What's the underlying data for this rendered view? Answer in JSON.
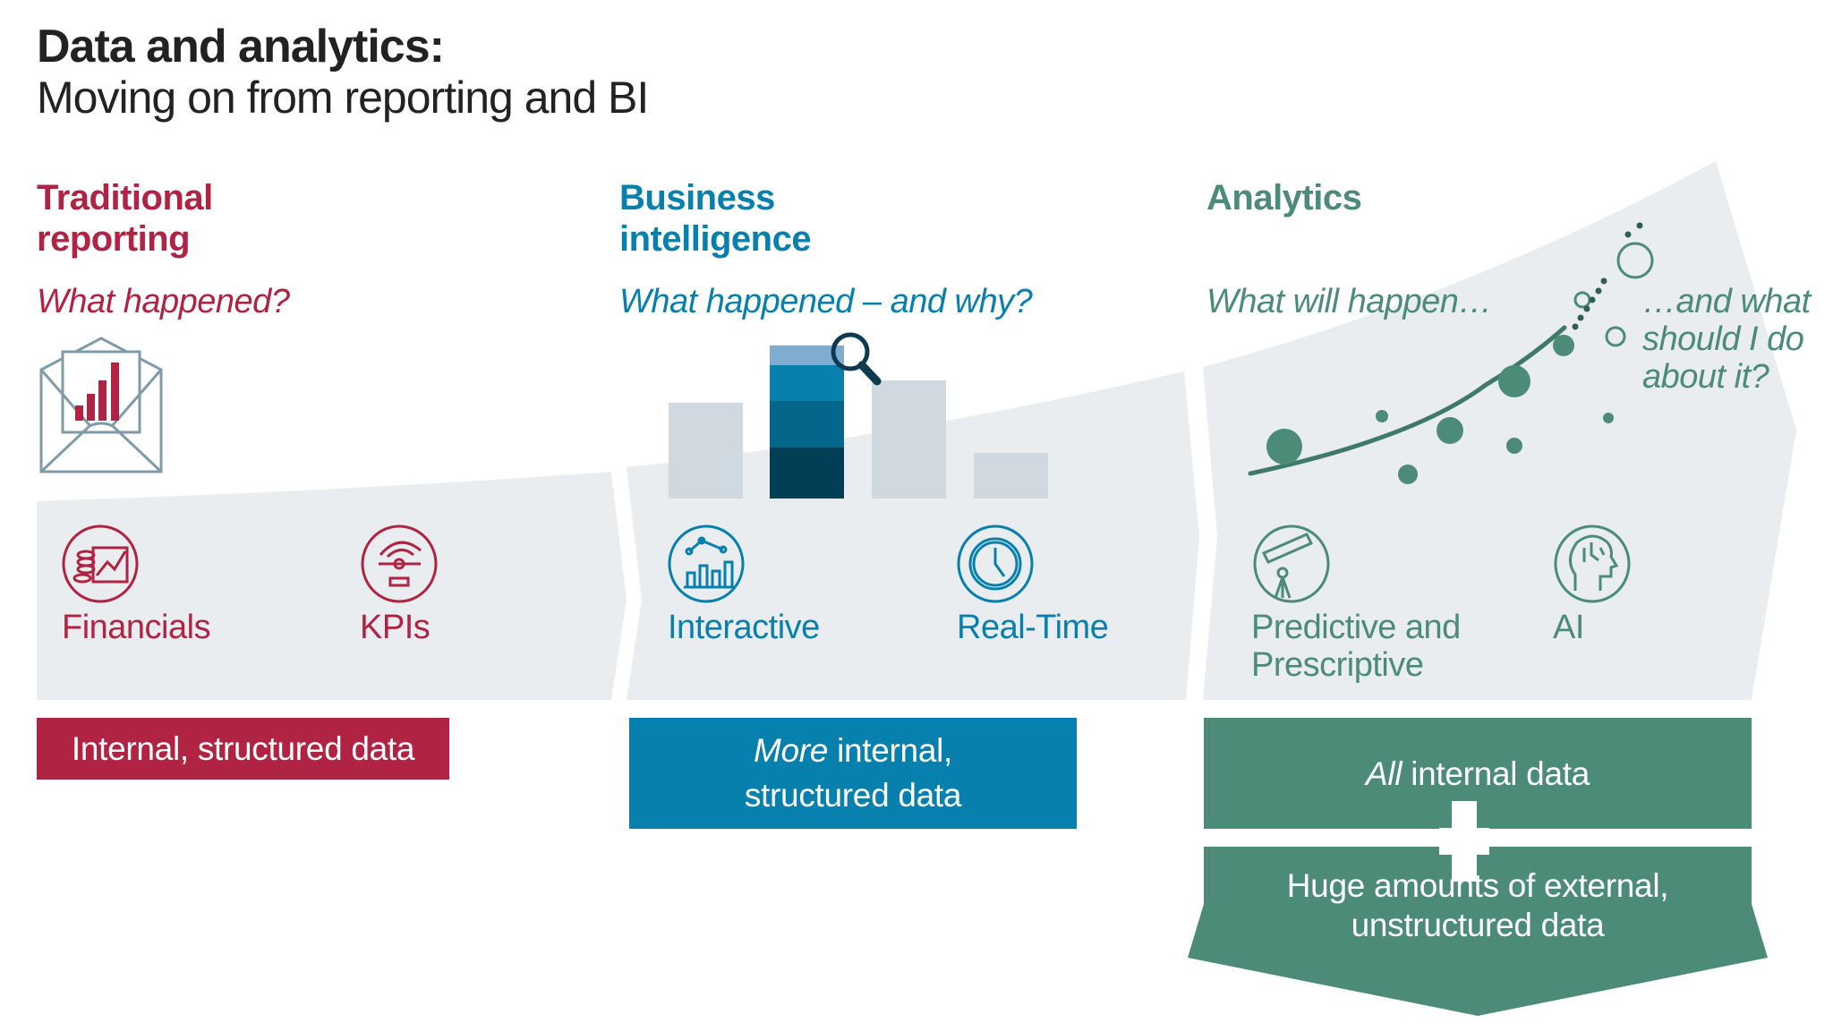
{
  "header": {
    "title": "Data and analytics:",
    "subtitle": "Moving on from reporting and BI"
  },
  "colors": {
    "traditional": "#b02343",
    "bi": "#0780ae",
    "analytics": "#4b8b78",
    "band": "#e9edf0",
    "bar_gray": "#cfd9df",
    "text_dark": "#222222"
  },
  "columns": [
    {
      "heading_line1": "Traditional",
      "heading_line2": "reporting",
      "question": "What happened?",
      "illustration": "envelope-report-icon",
      "features": [
        {
          "label": "Financials",
          "icon": "financials-coins-chart-icon"
        },
        {
          "label": "KPIs",
          "icon": "kpi-gauge-icon"
        }
      ],
      "data_box": {
        "lines": [
          "Internal, structured data"
        ]
      }
    },
    {
      "heading_line1": "Business",
      "heading_line2": "intelligence",
      "question": "What happened – and why?",
      "illustration": "bar-chart-magnifier-icon",
      "features": [
        {
          "label": "Interactive",
          "icon": "interactive-chart-cursor-icon"
        },
        {
          "label": "Real-Time",
          "icon": "clock-icon"
        }
      ],
      "data_box": {
        "emphasis": "More",
        "rest_line1": " internal,",
        "line2": "structured data"
      }
    },
    {
      "heading_line1": "Analytics",
      "question": "What will happen…",
      "question2_line1": "…and what",
      "question2_line2": "should I do",
      "question2_line3": "about it?",
      "illustration": "trend-scatter-icon",
      "features": [
        {
          "label_line1": "Predictive and",
          "label_line2": "Prescriptive",
          "icon": "telescope-icon"
        },
        {
          "label": "AI",
          "icon": "ai-head-icon"
        }
      ],
      "data_box": {
        "top_emphasis": "All",
        "top_rest": " internal data",
        "plus": "plus-icon",
        "bottom_line1": "Huge amounts of external,",
        "bottom_line2": "unstructured data"
      }
    }
  ]
}
